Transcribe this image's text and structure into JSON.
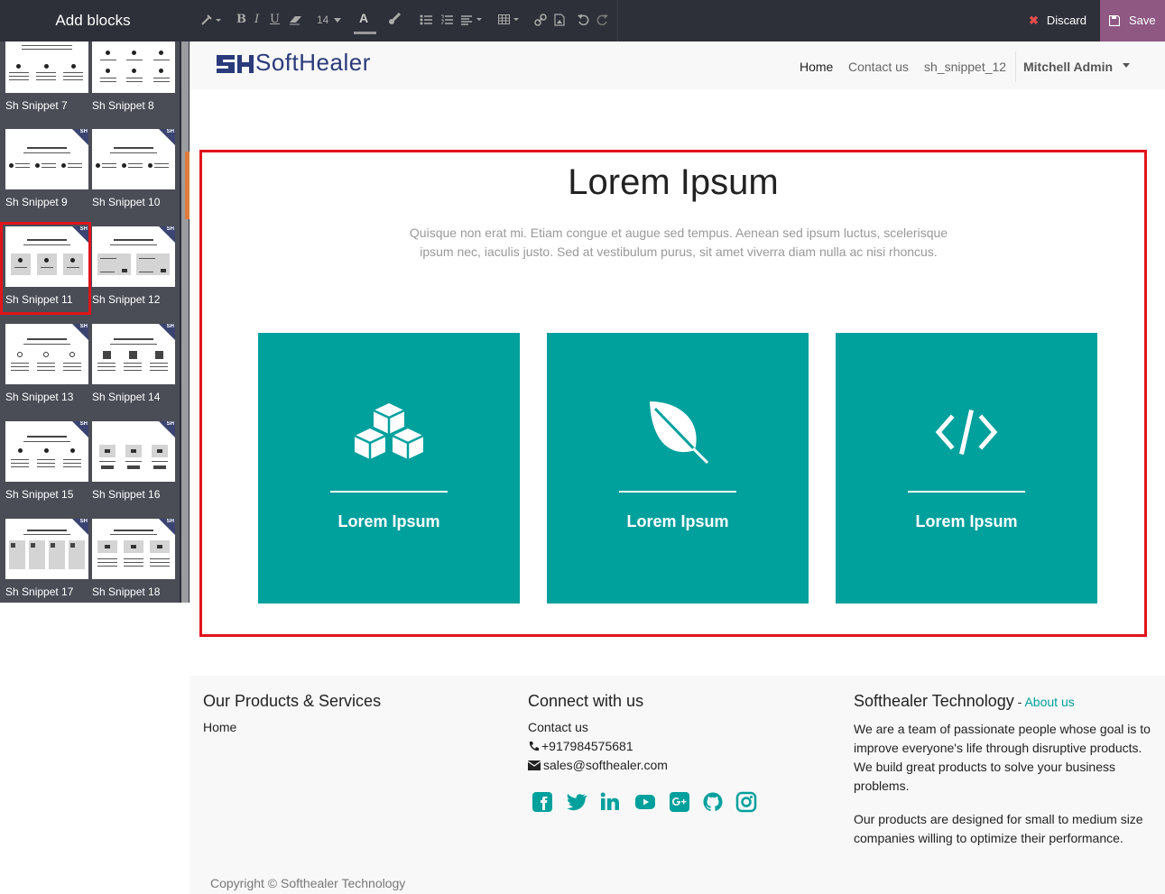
{
  "sidebar": {
    "title": "Add blocks",
    "snippets": [
      {
        "label": "Sh Snippet 7"
      },
      {
        "label": "Sh Snippet 8"
      },
      {
        "label": "Sh Snippet 9"
      },
      {
        "label": "Sh Snippet 10"
      },
      {
        "label": "Sh Snippet 11"
      },
      {
        "label": "Sh Snippet 12"
      },
      {
        "label": "Sh Snippet 13"
      },
      {
        "label": "Sh Snippet 14"
      },
      {
        "label": "Sh Snippet 15"
      },
      {
        "label": "Sh Snippet 16"
      },
      {
        "label": "Sh Snippet 17"
      },
      {
        "label": "Sh Snippet 18"
      }
    ],
    "badge": "SH",
    "selected": "Sh Snippet 11"
  },
  "toolbar": {
    "font_size": "14",
    "text_color_glyph": "A",
    "bold_glyph": "B",
    "italic_glyph": "I",
    "underline_glyph": "U",
    "discard_label": "Discard",
    "save_label": "Save"
  },
  "navbar": {
    "logo_prefix": "Sof",
    "logo_mid": "t",
    "logo_suffix": "Healer",
    "links": [
      "Home",
      "Contact us",
      "sh_snippet_12"
    ],
    "user": "Mitchell Admin"
  },
  "section": {
    "title": "Lorem Ipsum",
    "subtitle_line1": "Quisque non erat mi. Etiam congue et augue sed tempus. Aenean sed ipsum luctus, scelerisque",
    "subtitle_line2": "ipsum nec, iaculis justo. Sed at vestibulum purus, sit amet viverra diam nulla ac nisi rhoncus.",
    "cards": [
      {
        "icon": "cubes-icon",
        "title": "Lorem Ipsum"
      },
      {
        "icon": "leaf-icon",
        "title": "Lorem Ipsum"
      },
      {
        "icon": "code-icon",
        "title": "Lorem Ipsum"
      }
    ],
    "card_color": "#00a09d"
  },
  "footer": {
    "col1_title": "Our Products & Services",
    "col1_link": "Home",
    "col2_title": "Connect with us",
    "col2_link": "Contact us",
    "phone": "+917984575681",
    "email": "sales@softhealer.com",
    "social": [
      "facebook-icon",
      "twitter-icon",
      "linkedin-icon",
      "youtube-icon",
      "google-plus-icon",
      "github-icon",
      "instagram-icon"
    ],
    "col3_title": "Softhealer Technology",
    "col3_sep": " - ",
    "col3_link": "About us",
    "about_p1": "We are a team of passionate people whose goal is to improve everyone's life through disruptive products. We build great products to solve your business problems.",
    "about_p2": "Our products are designed for small to medium size companies willing to optimize their performance.",
    "copyright": "Copyright © Softhealer Technology"
  },
  "colors": {
    "accent": "#00a09d",
    "selection": "#e0141b",
    "save_bg": "#8e5883",
    "dark": "#2d3039"
  }
}
